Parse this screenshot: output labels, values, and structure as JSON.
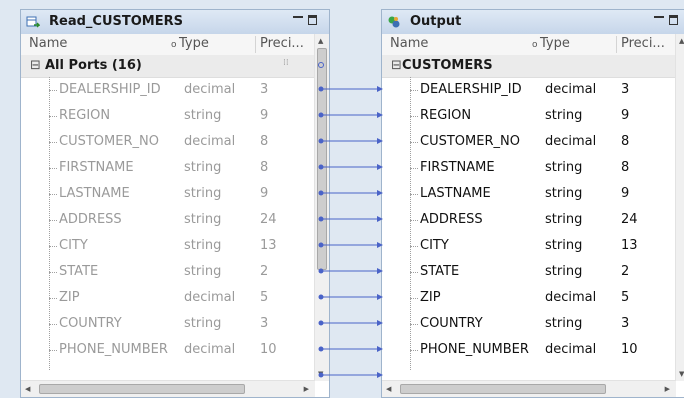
{
  "left_panel": {
    "title": "Read_CUSTOMERS",
    "icon": "read-transform-icon",
    "columns": [
      "Name",
      "Type",
      "Preci..."
    ],
    "group_label": "All Ports (16)",
    "group_toggle": "⊟",
    "rows": [
      {
        "name": "DEALERSHIP_ID",
        "type": "decimal",
        "precision": "3"
      },
      {
        "name": "REGION",
        "type": "string",
        "precision": "9"
      },
      {
        "name": "CUSTOMER_NO",
        "type": "decimal",
        "precision": "8"
      },
      {
        "name": "FIRSTNAME",
        "type": "string",
        "precision": "8"
      },
      {
        "name": "LASTNAME",
        "type": "string",
        "precision": "9"
      },
      {
        "name": "ADDRESS",
        "type": "string",
        "precision": "24"
      },
      {
        "name": "CITY",
        "type": "string",
        "precision": "13"
      },
      {
        "name": "STATE",
        "type": "string",
        "precision": "2"
      },
      {
        "name": "ZIP",
        "type": "decimal",
        "precision": "5"
      },
      {
        "name": "COUNTRY",
        "type": "string",
        "precision": "3"
      },
      {
        "name": "PHONE_NUMBER",
        "type": "decimal",
        "precision": "10"
      }
    ]
  },
  "right_panel": {
    "title": "Output",
    "icon": "output-transform-icon",
    "columns": [
      "Name",
      "Type",
      "Preci..."
    ],
    "group_label": "CUSTOMERS",
    "group_toggle": "⊟",
    "rows": [
      {
        "name": "DEALERSHIP_ID",
        "type": "decimal",
        "precision": "3"
      },
      {
        "name": "REGION",
        "type": "string",
        "precision": "9"
      },
      {
        "name": "CUSTOMER_NO",
        "type": "decimal",
        "precision": "8"
      },
      {
        "name": "FIRSTNAME",
        "type": "string",
        "precision": "8"
      },
      {
        "name": "LASTNAME",
        "type": "string",
        "precision": "9"
      },
      {
        "name": "ADDRESS",
        "type": "string",
        "precision": "24"
      },
      {
        "name": "CITY",
        "type": "string",
        "precision": "13"
      },
      {
        "name": "STATE",
        "type": "string",
        "precision": "2"
      },
      {
        "name": "ZIP",
        "type": "decimal",
        "precision": "5"
      },
      {
        "name": "COUNTRY",
        "type": "string",
        "precision": "3"
      },
      {
        "name": "PHONE_NUMBER",
        "type": "decimal",
        "precision": "10"
      }
    ]
  },
  "scroll_arrows": {
    "up": "▲",
    "down": "▼",
    "left": "◀",
    "right": "▶"
  },
  "colors": {
    "link": "#4a63c8",
    "panel_border": "#9fb4cc",
    "canvas": "#dfe8f2"
  }
}
